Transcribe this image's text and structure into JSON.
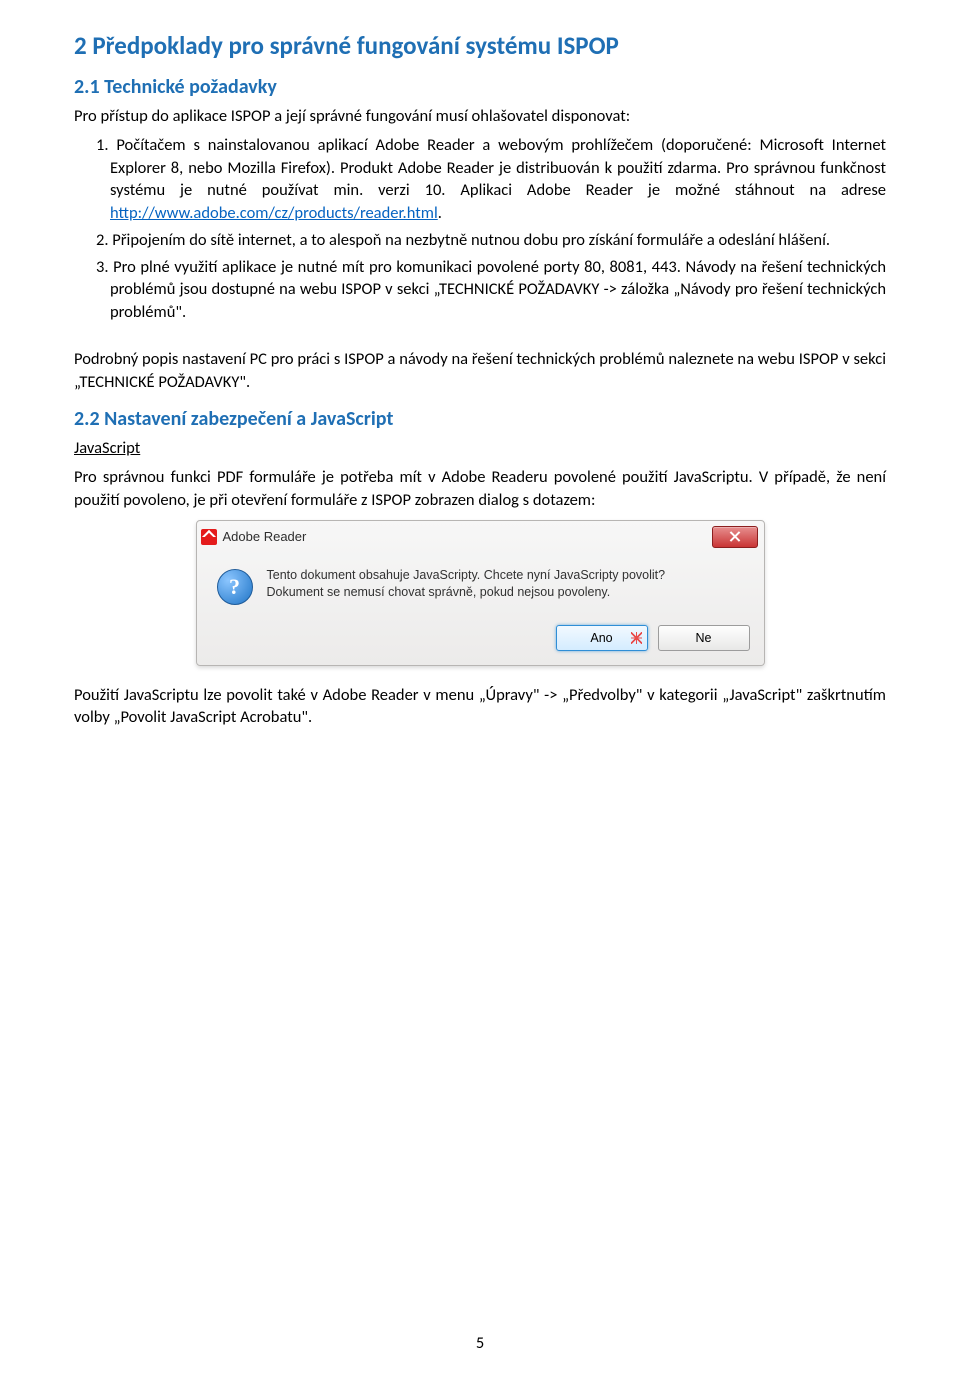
{
  "h1": "2   Předpoklady pro správné fungování systému ISPOP",
  "h2_1": "2.1   Technické požadavky",
  "intro": "Pro přístup do aplikace ISPOP a její správné fungování musí ohlašovatel disponovat:",
  "item1_pre": "1. Počítačem s nainstalovanou aplikací Adobe Reader a webovým prohlížečem (doporučené: Microsoft Internet Explorer 8, nebo Mozilla Firefox). Produkt Adobe Reader je distribuován k použití zdarma. Pro správnou funkčnost systému je nutné používat min. verzi 10. Aplikaci Adobe Reader je možné stáhnout na adrese ",
  "item1_link": "http://www.adobe.com/cz/products/reader.html",
  "item1_post": ".",
  "item2": "2. Připojením do sítě internet, a to alespoň na nezbytně nutnou dobu pro získání formuláře a odeslání hlášení.",
  "item3": "3. Pro plné využití aplikace je nutné mít pro komunikaci povolené porty 80, 8081, 443. Návody na řešení technických problémů jsou dostupné na webu ISPOP v sekci „TECHNICKÉ POŽADAVKY -> záložka „Návody pro řešení technických problémů\".",
  "para2": "Podrobný popis nastavení PC pro práci s ISPOP a návody na řešení technických problémů naleznete na webu ISPOP v sekci „TECHNICKÉ POŽADAVKY\".",
  "h2_2": "2.2   Nastavení zabezpečení a JavaScript",
  "js_heading": "JavaScript",
  "para3": "Pro správnou funkci PDF formuláře je potřeba mít v Adobe Readeru povolené použití JavaScriptu. V případě, že není použití povoleno, je při otevření formuláře z ISPOP zobrazen dialog s dotazem:",
  "dialog": {
    "title": "Adobe Reader",
    "line1": "Tento dokument obsahuje JavaScripty. Chcete nyní JavaScripty povolit?",
    "line2": "Dokument se nemusí chovat správně, pokud nejsou povoleny.",
    "yes": "Ano",
    "no": "Ne"
  },
  "para4": "Použití JavaScriptu lze povolit také v Adobe Reader v menu „Úpravy\" -> „Předvolby\" v kategorii „JavaScript\" zaškrtnutím volby „Povolit JavaScript Acrobatu\".",
  "page_number": "5"
}
